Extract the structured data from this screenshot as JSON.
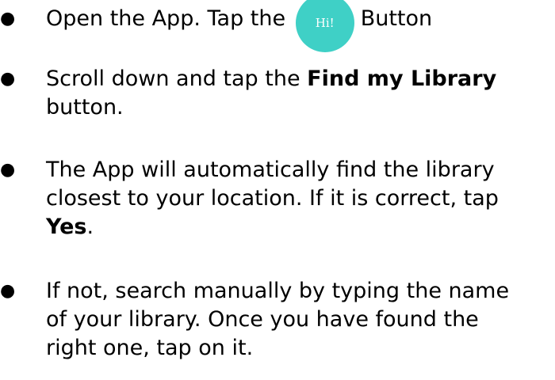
{
  "steps": [
    {
      "bullet": "●",
      "text_before": "Open the App. Tap the",
      "button_label": "Hi!",
      "text_after": "Button"
    },
    {
      "bullet": "●",
      "line1_text": "Scroll down and tap the ",
      "line1_bold": "Find my Library",
      "line2": "button."
    },
    {
      "bullet": "●",
      "line1": "The App will automatically find the library",
      "line2": "closest to your location. If it is correct, tap",
      "line3_bold": "Yes",
      "line3_after": "."
    },
    {
      "bullet": "●",
      "line1": "If not, search manually by typing the name",
      "line2": "of your library. Once you have found the",
      "line3": "right one, tap on it."
    }
  ],
  "colors": {
    "hi_button": "#3fd0c6",
    "text": "#000000"
  }
}
